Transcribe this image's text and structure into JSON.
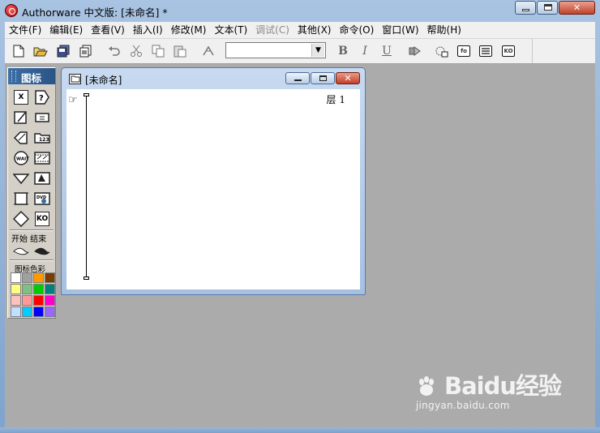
{
  "window": {
    "title": "Authorware 中文版: [未命名] *"
  },
  "menu": {
    "items": [
      {
        "label": "文件(F)",
        "enabled": true
      },
      {
        "label": "编辑(E)",
        "enabled": true
      },
      {
        "label": "查看(V)",
        "enabled": true
      },
      {
        "label": "插入(I)",
        "enabled": true
      },
      {
        "label": "修改(M)",
        "enabled": true
      },
      {
        "label": "文本(T)",
        "enabled": true
      },
      {
        "label": "调试(C)",
        "enabled": false
      },
      {
        "label": "其他(X)",
        "enabled": true
      },
      {
        "label": "命令(O)",
        "enabled": true
      },
      {
        "label": "窗口(W)",
        "enabled": true
      },
      {
        "label": "帮助(H)",
        "enabled": true
      }
    ]
  },
  "toolbar": {
    "font_combo_value": "",
    "bold_glyph": "B",
    "italic_glyph": "I",
    "underline_glyph": "U",
    "box_fo": "fo",
    "box_ko": "KO",
    "icons": [
      "new-icon",
      "open-icon",
      "save-all-icon",
      "import-icon",
      "undo-icon",
      "cut-icon",
      "copy-icon",
      "paste-icon",
      "find-icon",
      "bold-icon",
      "italic-icon",
      "underline-icon",
      "run-icon",
      "control-panel-icon",
      "functions-icon",
      "variables-icon",
      "knowledge-objects-icon"
    ]
  },
  "palette": {
    "title": "图标",
    "flags_label": "开始 结束",
    "colors_label": "图标色彩",
    "icons": [
      "display-icon",
      "motion-icon",
      "erase-icon",
      "wait-icon",
      "navigate-icon",
      "framework-icon",
      "decision-icon",
      "interaction-icon",
      "calculation-icon",
      "map-icon",
      "digital-movie-icon",
      "sound-icon",
      "video-icon",
      "knowledge-object-icon"
    ],
    "icon_box_ko": "KO",
    "colors": [
      "#ffffff",
      "#a0a0a0",
      "#ff9900",
      "#7a3d00",
      "#ffff80",
      "#80c080",
      "#00cc00",
      "#008080",
      "#ffc0c0",
      "#ff9999",
      "#ff0000",
      "#ff00cc",
      "#c0e0ff",
      "#00ccff",
      "#0000ff",
      "#9966ff"
    ]
  },
  "design_window": {
    "title": "[未命名]",
    "layer_label": "层 1"
  },
  "watermark": {
    "brand": "Baidu经验",
    "url": "jingyan.baidu.com"
  }
}
